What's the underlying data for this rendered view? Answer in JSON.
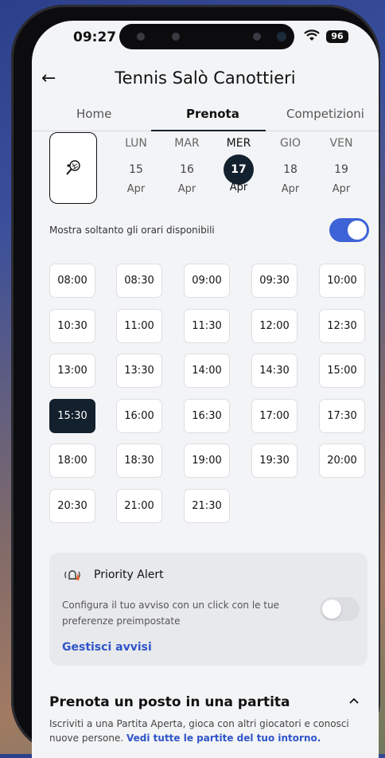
{
  "status": {
    "time": "09:27",
    "battery": "96"
  },
  "header": {
    "title": "Tennis Salò Canottieri"
  },
  "tabs": [
    {
      "label": "Home",
      "active": false
    },
    {
      "label": "Prenota",
      "active": true
    },
    {
      "label": "Competizioni",
      "active": false
    }
  ],
  "days": [
    {
      "name": "LUN",
      "num": "15",
      "month": "Apr",
      "selected": false
    },
    {
      "name": "MAR",
      "num": "16",
      "month": "Apr",
      "selected": false
    },
    {
      "name": "MER",
      "num": "17",
      "month": "Apr",
      "selected": true
    },
    {
      "name": "GIO",
      "num": "18",
      "month": "Apr",
      "selected": false
    },
    {
      "name": "VEN",
      "num": "19",
      "month": "Apr",
      "selected": false
    }
  ],
  "availability": {
    "label": "Mostra soltanto gli orari disponibili",
    "enabled": true
  },
  "slots": [
    "08:00",
    "08:30",
    "09:00",
    "09:30",
    "10:00",
    "10:30",
    "11:00",
    "11:30",
    "12:00",
    "12:30",
    "13:00",
    "13:30",
    "14:00",
    "14:30",
    "15:00",
    "15:30",
    "16:00",
    "16:30",
    "17:00",
    "17:30",
    "18:00",
    "18:30",
    "19:00",
    "19:30",
    "20:00",
    "20:30",
    "21:00",
    "21:30"
  ],
  "selected_slot": "15:30",
  "priority_alert": {
    "title": "Priority Alert",
    "description": "Configura il tuo avviso con un click con le tue preferenze preimpostate",
    "link": "Gestisci avvisi",
    "enabled": false
  },
  "join_match": {
    "title": "Prenota un posto in una partita",
    "description": "Iscriviti a una Partita Aperta, gioca con altri giocatori e conosci nuove persone.",
    "link": "Vedi tutte le partite del tuo intorno."
  },
  "colors": {
    "accent": "#3d63d6",
    "dark": "#13202e",
    "link": "#2f55c9"
  }
}
